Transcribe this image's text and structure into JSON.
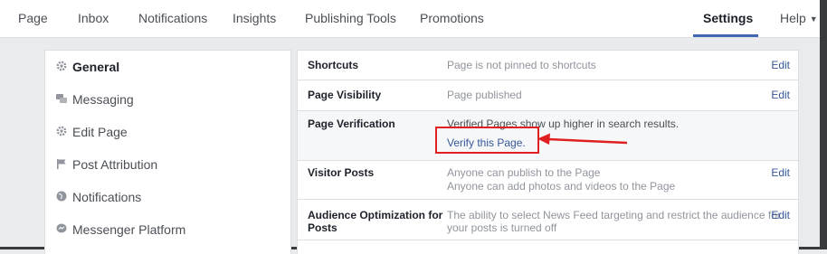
{
  "nav": {
    "items": [
      "Page",
      "Inbox",
      "Notifications",
      "Insights",
      "Publishing Tools",
      "Promotions",
      "Settings",
      "Help"
    ],
    "active": "Settings"
  },
  "sidebar": {
    "items": [
      {
        "label": "General",
        "icon": "gear-icon",
        "active": true
      },
      {
        "label": "Messaging",
        "icon": "chat-bubbles-icon"
      },
      {
        "label": "Edit Page",
        "icon": "gear-icon"
      },
      {
        "label": "Post Attribution",
        "icon": "flag-icon"
      },
      {
        "label": "Notifications",
        "icon": "globe-icon"
      },
      {
        "label": "Messenger Platform",
        "icon": "messenger-icon"
      }
    ]
  },
  "settings": {
    "rows": [
      {
        "label": "Shortcuts",
        "value": "Page is not pinned to shortcuts",
        "edit": "Edit"
      },
      {
        "label": "Page Visibility",
        "value": "Page published",
        "edit": "Edit"
      },
      {
        "label": "Page Verification",
        "value": "Verified Pages show up higher in search results.",
        "link": "Verify this Page."
      },
      {
        "label": "Visitor Posts",
        "value": "Anyone can publish to the Page",
        "value2": "Anyone can add photos and videos to the Page",
        "edit": "Edit"
      },
      {
        "label": "Audience Optimization for",
        "label2": "Posts",
        "value": "The ability to select News Feed targeting and restrict the audience for",
        "value2": "your posts is turned off",
        "edit": "Edit"
      }
    ]
  },
  "colors": {
    "accent": "#4267b2",
    "link": "#365899",
    "annotation": "#e02020",
    "background": "#e9ebee"
  }
}
